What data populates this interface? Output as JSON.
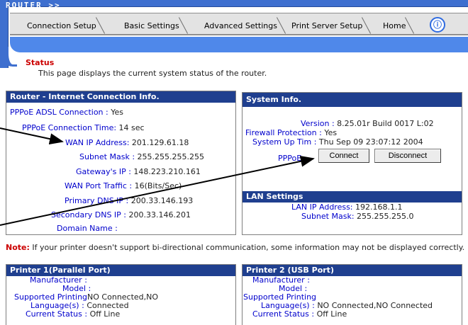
{
  "header": {
    "logo": "ROUTER >>",
    "tabs": [
      "Connection Setup",
      "Basic Settings",
      "Advanced Settings",
      "Print Server Setup",
      "Home"
    ],
    "info_icon": "ⓘ"
  },
  "page": {
    "title": "Status",
    "description": "This page displays the current system status of the router."
  },
  "router_info": {
    "heading": "Router - Internet Connection Info.",
    "rows": [
      {
        "k": "PPPoE ADSL Connection : ",
        "v": "Yes"
      },
      {
        "k": "PPPoE Connection Time: ",
        "v": "14 sec"
      },
      {
        "k": "WAN IP Address: ",
        "v": "201.129.61.18"
      },
      {
        "k": "Subnet Mask : ",
        "v": "255.255.255.255"
      },
      {
        "k": "Gateway's IP : ",
        "v": "148.223.210.161"
      },
      {
        "k": "WAN Port Traffic : ",
        "v": "16(Bits/Sec)"
      },
      {
        "k": "Primary DNS IP : ",
        "v": "200.33.146.193"
      },
      {
        "k": "Secondary DNS IP : ",
        "v": "200.33.146.201"
      },
      {
        "k": "Domain Name : ",
        "v": ""
      }
    ]
  },
  "system_info": {
    "heading": "System Info.",
    "rows": [
      {
        "k": "Version : ",
        "v": "8.25.01r Build 0017 L:02"
      },
      {
        "k": "Firewall Protection : ",
        "v": "Yes"
      },
      {
        "k": "System Up Tim : ",
        "v": "Thu Sep 09 23:07:12 2004"
      },
      {
        "k": "PPPoE : ",
        "v": ""
      }
    ],
    "connect_label": "Connect",
    "disconnect_label": "Disconnect"
  },
  "lan_settings": {
    "heading": "LAN Settings",
    "rows": [
      {
        "k": "LAN IP Address: ",
        "v": "192.168.1.1"
      },
      {
        "k": "Subnet Mask: ",
        "v": "255.255.255.0"
      }
    ]
  },
  "note": {
    "label": "Note:",
    "text": " If your printer doesn't support bi-directional communication, some information may not be displayed correctly."
  },
  "printer1": {
    "heading": "Printer 1(Parallel Port)",
    "rows": [
      {
        "k": "Manufacturer : ",
        "v": ""
      },
      {
        "k": "Model : ",
        "v": ""
      },
      {
        "k": "Supported Printing",
        "v": "NO Connected,NO"
      },
      {
        "k": "Language(s) : ",
        "v": "Connected"
      },
      {
        "k": "Current Status : ",
        "v": "Off Line"
      }
    ]
  },
  "printer2": {
    "heading": "Printer 2 (USB Port)",
    "rows": [
      {
        "k": "Manufacturer : ",
        "v": ""
      },
      {
        "k": "Model : ",
        "v": ""
      },
      {
        "k": "Supported Printing",
        "v": ""
      },
      {
        "k": "Language(s) : ",
        "v": "NO Connected,NO Connected"
      },
      {
        "k": "Current Status : ",
        "v": "Off Line"
      }
    ]
  },
  "colors": {
    "header_blue": "#3e6fcf",
    "panel_head": "#1f3f8f",
    "label_blue": "#0000cc",
    "title_red": "#cc0000"
  }
}
